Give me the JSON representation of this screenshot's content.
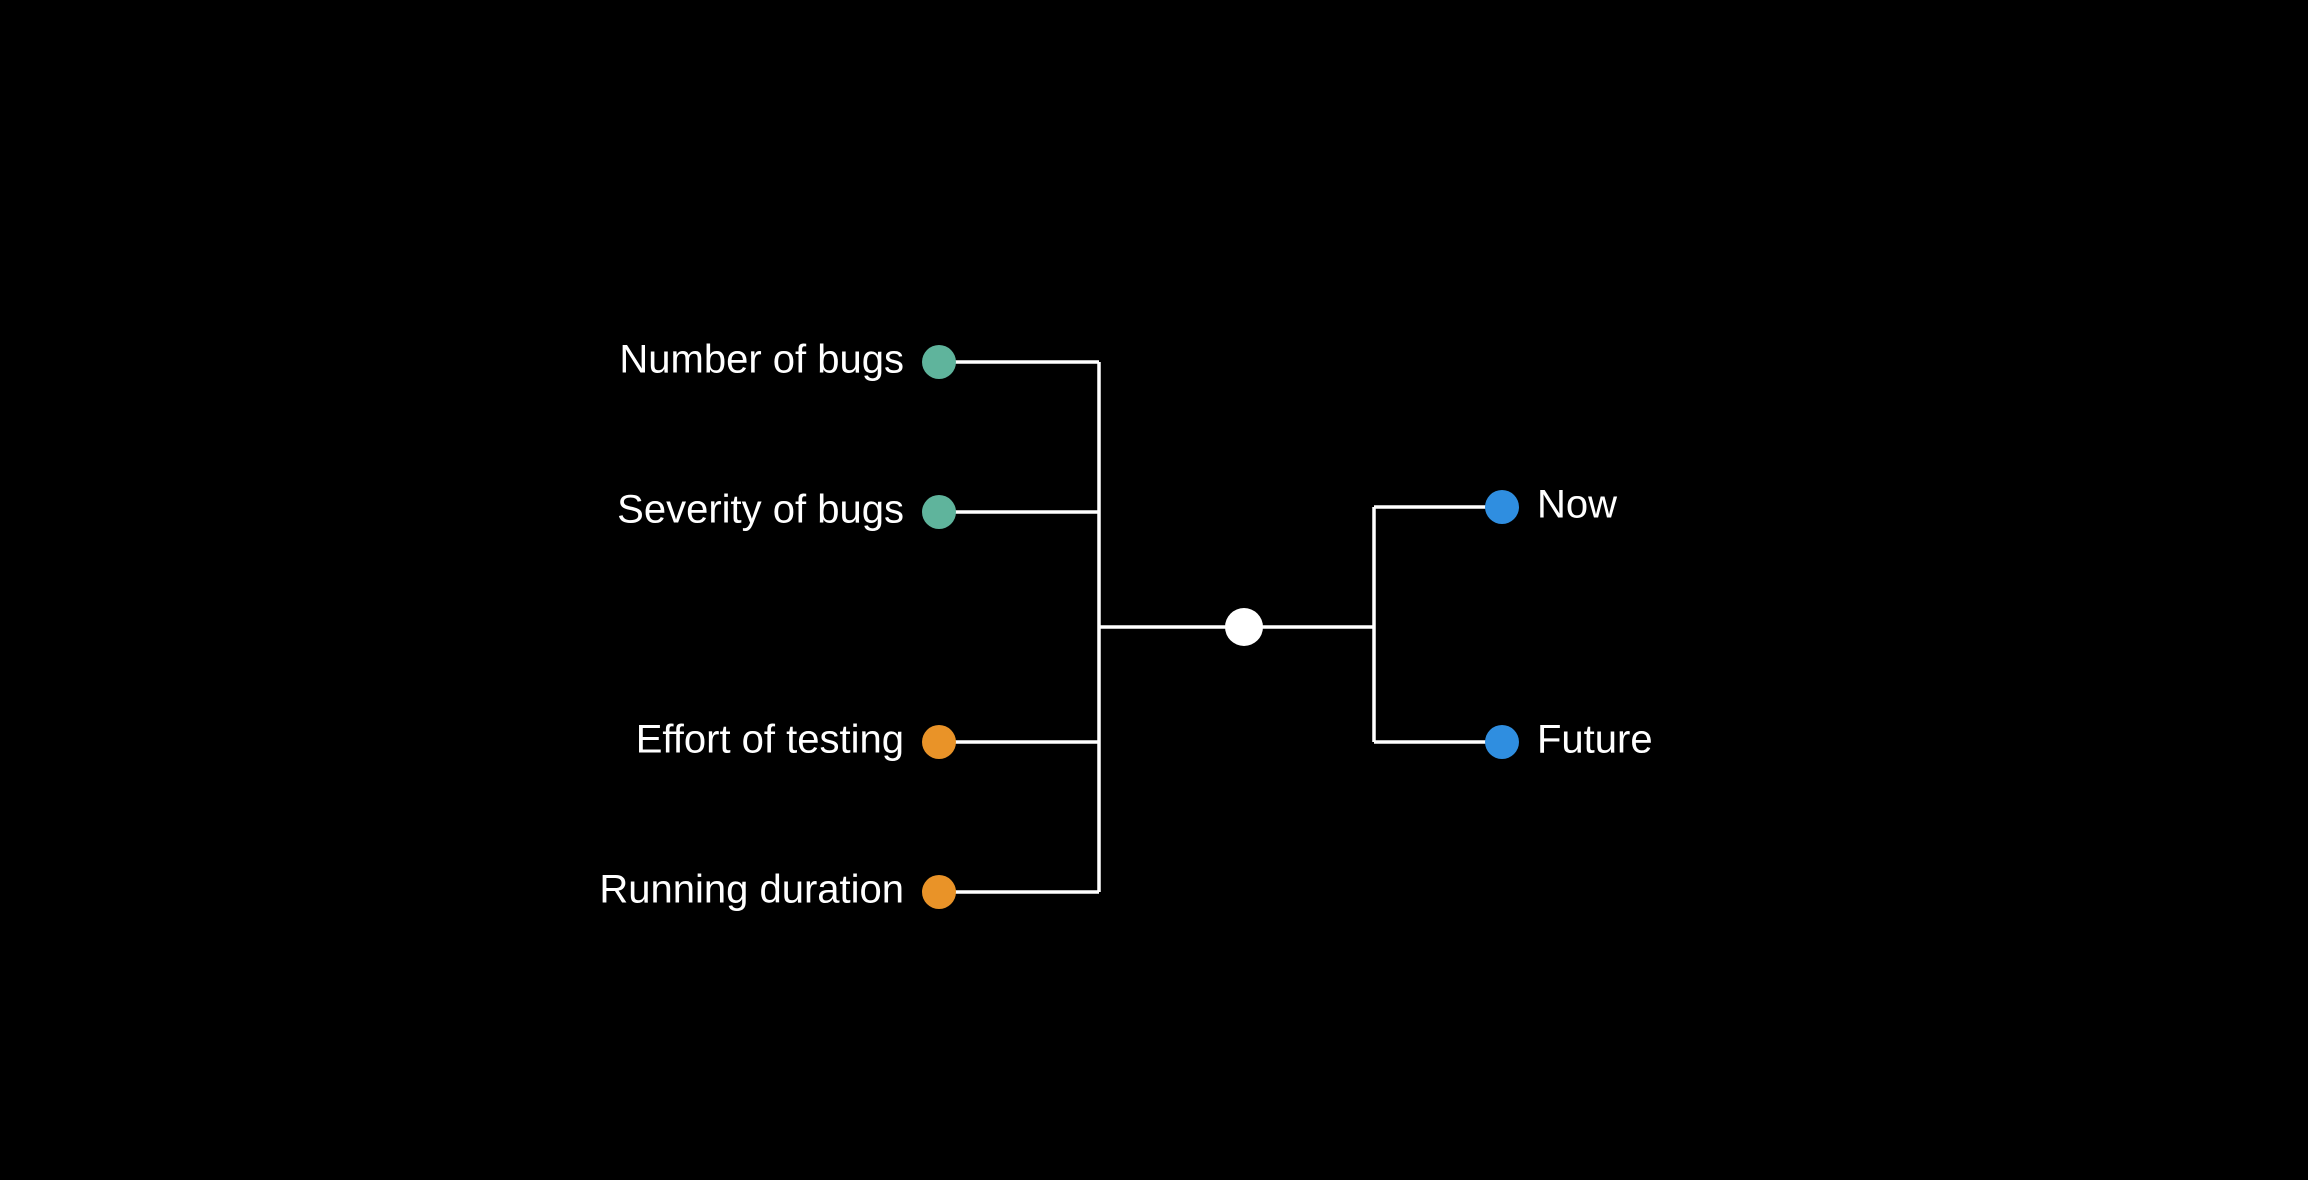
{
  "diagram": {
    "left_nodes": [
      {
        "label": "Number of bugs",
        "color": "#5fb49c"
      },
      {
        "label": "Severity of bugs",
        "color": "#5fb49c"
      },
      {
        "label": "Effort of testing",
        "color": "#e99328"
      },
      {
        "label": "Running duration",
        "color": "#e99328"
      }
    ],
    "center_node": {
      "color": "#ffffff"
    },
    "right_nodes": [
      {
        "label": "Now",
        "color": "#2f8ee0"
      },
      {
        "label": "Future",
        "color": "#2f8ee0"
      }
    ],
    "colors": {
      "line": "#ffffff",
      "text": "#ffffff",
      "background": "#000000"
    }
  }
}
